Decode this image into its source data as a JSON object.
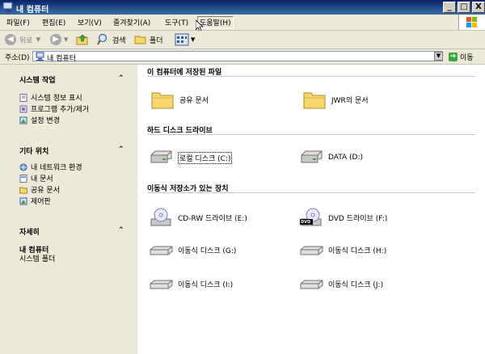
{
  "window": {
    "title": "내 컴퓨터",
    "controls": {
      "minimize": "_",
      "maximize": "□",
      "close": "X"
    }
  },
  "menubar": {
    "items": [
      {
        "label": "파일(F)"
      },
      {
        "label": "편집(E)"
      },
      {
        "label": "보기(V)"
      },
      {
        "label": "즐겨찾기(A)"
      },
      {
        "label": "도구(T)"
      },
      {
        "label": "도움말(H)"
      }
    ]
  },
  "toolbar": {
    "back_label": "뒤로",
    "search_label": "검색",
    "folders_label": "폴더"
  },
  "address": {
    "label": "주소(D)",
    "value": "내 컴퓨터",
    "go_label": "이동"
  },
  "left_pane": {
    "system_tasks": {
      "title": "시스템 작업",
      "items": [
        "시스템 정보 표시",
        "프로그램 추가/제거",
        "설정 변경"
      ]
    },
    "other_places": {
      "title": "기타 위치",
      "items": [
        "내 네트워크 환경",
        "내 문서",
        "공유 문서",
        "제어판"
      ]
    },
    "details": {
      "title": "자세히",
      "name": "내 컴퓨터",
      "desc": "시스템 폴더"
    }
  },
  "right_pane": {
    "stored_files": {
      "title": "이 컴퓨터에 저장된 파일",
      "items": [
        "공유 문서",
        "JWR의 문서"
      ]
    },
    "hard_drives": {
      "title": "하드 디스크 드라이브",
      "items": [
        "로컬 디스크 (C:)",
        "DATA (D:)"
      ]
    },
    "removable": {
      "title": "이동식 저장소가 있는 장치",
      "items": [
        "CD-RW 드라이브 (E:)",
        "DVD 드라이브 (F:)",
        "이동식 디스크 (G:)",
        "이동식 디스크 (H:)",
        "이동식 디스크 (I:)",
        "이동식 디스크 (J:)"
      ],
      "dvd_badge": "DVD"
    }
  },
  "colors": {
    "titlebar_start": "#0a246a",
    "titlebar_end": "#3a6ea5",
    "pane_bg": "#ece9d8",
    "folder": "#f5d76e"
  }
}
